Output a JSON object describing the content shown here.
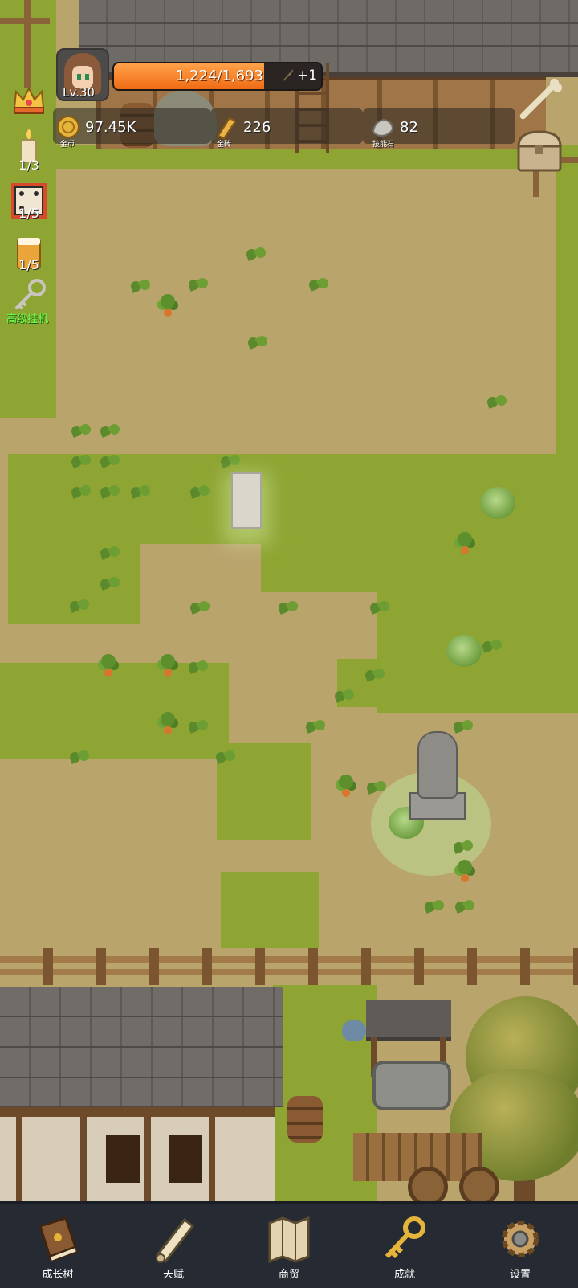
{
  "player": {
    "level": "Lv.30",
    "xp_text": "1,224/1,693",
    "xp_fraction": 0.723,
    "xp_bonus": "+1"
  },
  "resources": [
    {
      "icon": "gold-coin-icon",
      "value": "97.45K",
      "label": "金币"
    },
    {
      "icon": "gold-bar-icon",
      "value": "226",
      "label": "金砖"
    },
    {
      "icon": "skill-stone-icon",
      "value": "82",
      "label": "技能石"
    }
  ],
  "side_buttons": [
    {
      "icon": "crown-icon",
      "count": ""
    },
    {
      "icon": "candle-icon",
      "count": "1/3"
    },
    {
      "icon": "dice-icon",
      "count": "1/5"
    },
    {
      "icon": "beer-mug-icon",
      "count": "1/5"
    },
    {
      "icon": "key-icon",
      "label": "高级挂机"
    }
  ],
  "right_buttons": [
    {
      "icon": "bone-icon"
    },
    {
      "icon": "treasure-chest-icon"
    }
  ],
  "nav": [
    {
      "icon": "book-icon",
      "label": "成长树"
    },
    {
      "icon": "scroll-icon",
      "label": "天赋"
    },
    {
      "icon": "map-icon",
      "label": "商贸"
    },
    {
      "icon": "golden-key-icon",
      "label": "成就"
    },
    {
      "icon": "gear-icon",
      "label": "设置"
    }
  ],
  "colors": {
    "xp_fill": "#ef6b14",
    "dirt": "#b9a46c",
    "grass": "#8ea533",
    "nav_bg": "#262a33",
    "idle_label": "#6dff4a"
  }
}
